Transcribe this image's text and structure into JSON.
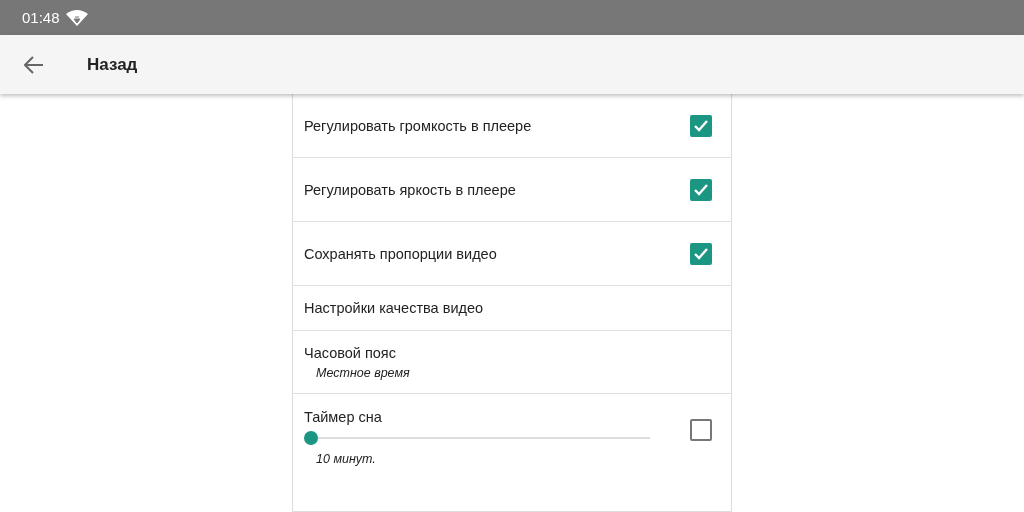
{
  "status_bar": {
    "time": "01:48"
  },
  "app_bar": {
    "title": "Назад"
  },
  "settings": [
    {
      "kind": "checkbox",
      "label": "Регулировать громкость в плеере",
      "checked": true
    },
    {
      "kind": "checkbox",
      "label": "Регулировать яркость в плеере",
      "checked": true
    },
    {
      "kind": "checkbox",
      "label": "Сохранять пропорции видео",
      "checked": true
    },
    {
      "kind": "plain",
      "label": "Настройки качества видео"
    },
    {
      "kind": "subtitle",
      "label": "Часовой пояс",
      "subtitle": "Местное время"
    },
    {
      "kind": "slider",
      "label": "Таймер сна",
      "level": 0,
      "reading": "10 минут.",
      "checked": false
    }
  ]
}
